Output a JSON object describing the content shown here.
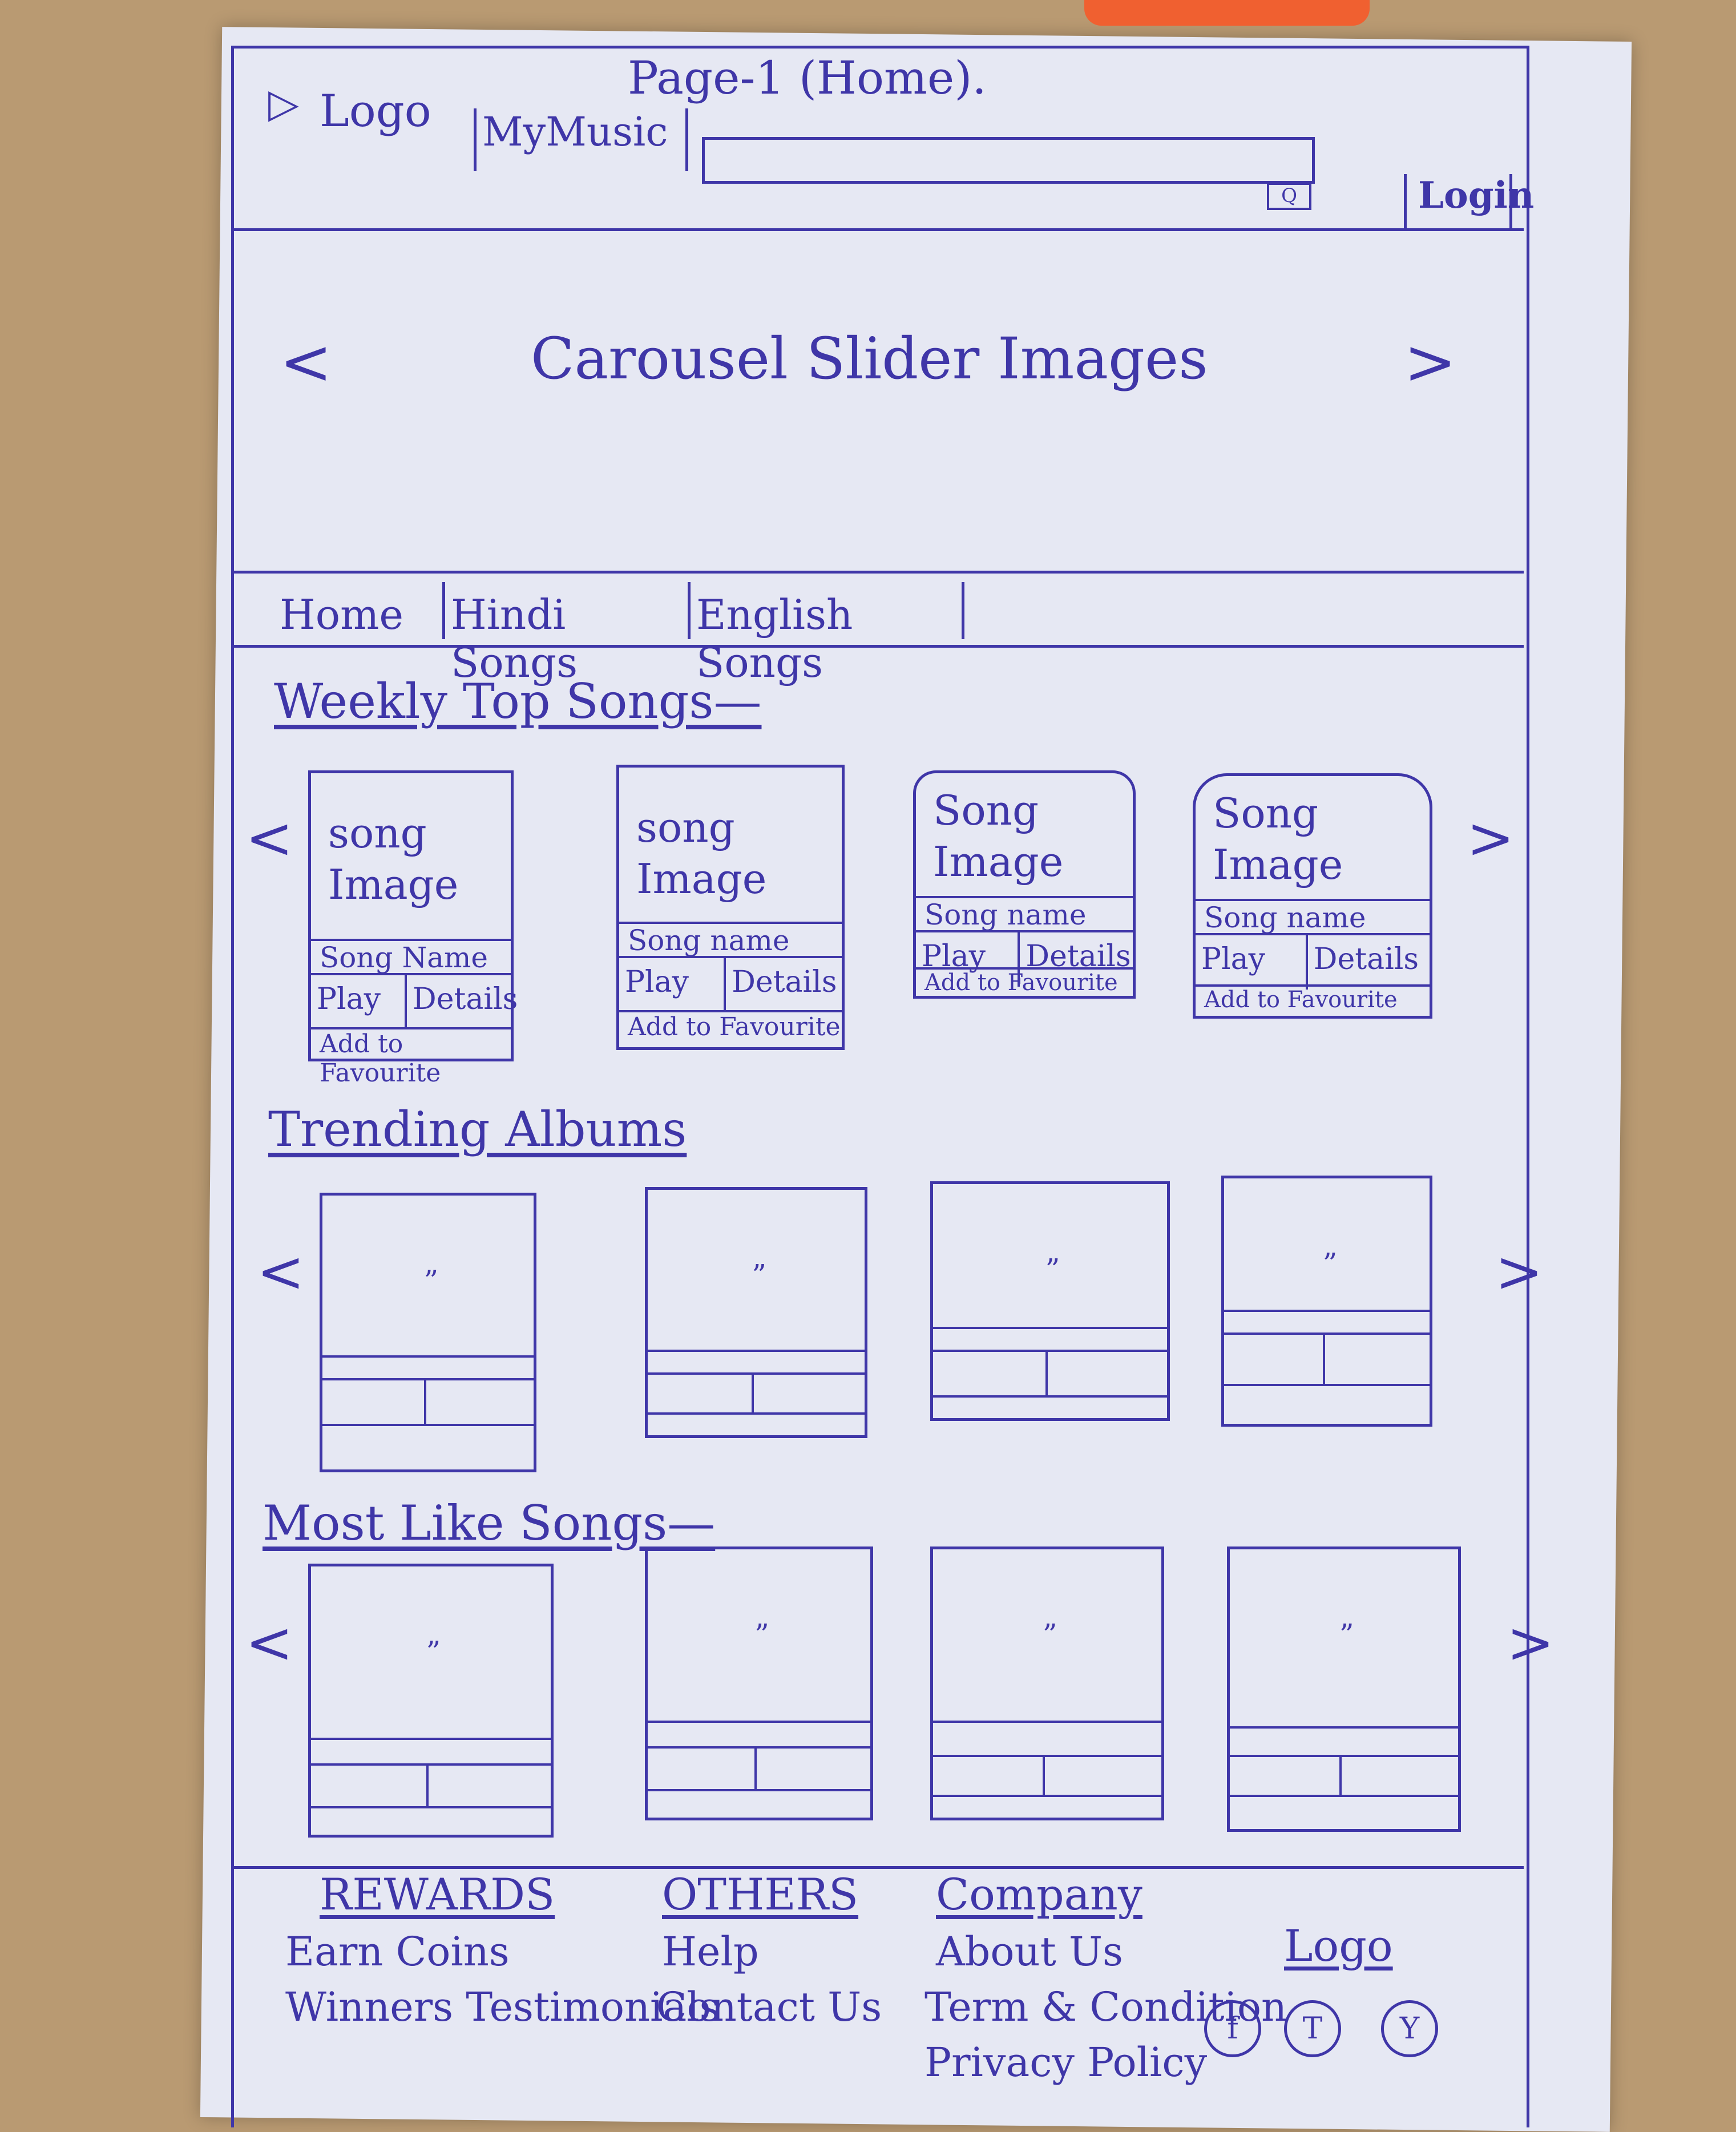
{
  "page_title": "Page-1 (Home).",
  "header": {
    "logo_label": "Logo",
    "brand": "MyMusic",
    "search_placeholder": "",
    "search_button": "Q",
    "login": "Login"
  },
  "carousel": {
    "prev": "<",
    "next": ">",
    "title": "Carousel Slider Images"
  },
  "nav": {
    "tabs": [
      "Home",
      "Hindi Songs",
      "English Songs"
    ]
  },
  "weekly": {
    "title": "Weekly Top Songs—",
    "prev": "<",
    "next": ">",
    "cards": [
      {
        "image": "song Image",
        "name": "Song Name",
        "play": "Play",
        "details": "Details",
        "fav": "Add to Favourite"
      },
      {
        "image": "song Image",
        "name": "Song name",
        "play": "Play",
        "details": "Details",
        "fav": "Add to Favourite"
      },
      {
        "image": "Song Image",
        "name": "Song name",
        "play": "Play",
        "details": "Details",
        "fav": "Add to Favourite"
      },
      {
        "image": "Song Image",
        "name": "Song name",
        "play": "Play",
        "details": "Details",
        "fav": "Add to Favourite"
      }
    ]
  },
  "trending": {
    "title": "Trending Albums",
    "prev": "<",
    "next": ">",
    "ditto": "”"
  },
  "mostliked": {
    "title": "Most Like Songs—",
    "prev": "<",
    "next": ">",
    "ditto": "”"
  },
  "footer": {
    "rewards": {
      "title": "REWARDS",
      "links": [
        "Earn Coins",
        "Winners Testimonials"
      ]
    },
    "others": {
      "title": "OTHERS",
      "links": [
        "Help",
        "Contact Us"
      ]
    },
    "company": {
      "title": "Company",
      "links": [
        "About Us",
        "Term & Condition",
        "Privacy Policy"
      ]
    },
    "logo": "Logo",
    "social": [
      "f",
      "T",
      "Y"
    ]
  }
}
